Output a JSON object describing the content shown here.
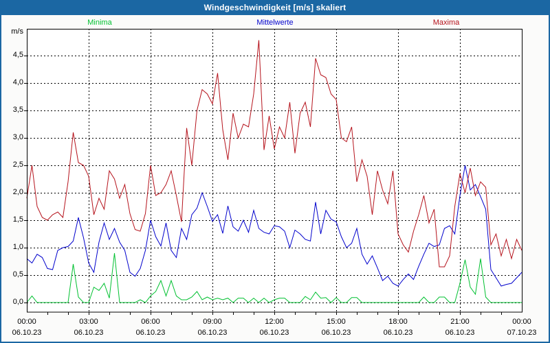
{
  "window": {
    "title": "Windgeschwindigkeit [m/s] skaliert"
  },
  "colors": {
    "titlebar": "#1B67A3",
    "border": "#1B67A3",
    "minima": "#00C030",
    "mittelwerte": "#0000CC",
    "maxima": "#B5121B",
    "grid": "#000000",
    "text": "#000000",
    "plot_bg": "#FFFFFF"
  },
  "legend": {
    "minima_label": "Minima",
    "mittelwerte_label": "Mittelwerte",
    "maxima_label": "Maxima"
  },
  "y_axis": {
    "unit": "m/s",
    "ticks": [
      {
        "value": 0.0,
        "label": "0,0"
      },
      {
        "value": 0.5,
        "label": "0,5"
      },
      {
        "value": 1.0,
        "label": "1,0"
      },
      {
        "value": 1.5,
        "label": "1,5"
      },
      {
        "value": 2.0,
        "label": "2,0"
      },
      {
        "value": 2.5,
        "label": "2,5"
      },
      {
        "value": 3.0,
        "label": "3,0"
      },
      {
        "value": 3.5,
        "label": "3,5"
      },
      {
        "value": 4.0,
        "label": "4,0"
      },
      {
        "value": 4.5,
        "label": "4,5"
      }
    ]
  },
  "x_axis": {
    "ticks": [
      {
        "time": "00:00",
        "date": "06.10.23"
      },
      {
        "time": "03:00",
        "date": "06.10.23"
      },
      {
        "time": "06:00",
        "date": "06.10.23"
      },
      {
        "time": "09:00",
        "date": "06.10.23"
      },
      {
        "time": "12:00",
        "date": "06.10.23"
      },
      {
        "time": "15:00",
        "date": "06.10.23"
      },
      {
        "time": "18:00",
        "date": "06.10.23"
      },
      {
        "time": "21:00",
        "date": "06.10.23"
      },
      {
        "time": "00:00",
        "date": "07.10.23"
      }
    ]
  },
  "chart_data": {
    "type": "line",
    "title": "Windgeschwindigkeit [m/s] skaliert",
    "ylabel": "m/s",
    "ylim": [
      0,
      5.0
    ],
    "xlim_hours": [
      0,
      24
    ],
    "x_start_hours": 0,
    "x_step_hours": 0.25,
    "grid": "dashed, every 0.5 m/s horizontal and every 3 h vertical",
    "legend_position": "top",
    "series": [
      {
        "name": "Minima",
        "color": "#00C030",
        "values": [
          0,
          0.12,
          0,
          0,
          0,
          0,
          0,
          0,
          0,
          0.7,
          0.1,
          0,
          0,
          0.28,
          0.22,
          0.35,
          0.08,
          0.9,
          0,
          0,
          0,
          0,
          0.05,
          0,
          0.12,
          0.2,
          0.4,
          0.12,
          0.4,
          0.12,
          0.05,
          0.05,
          0.1,
          0.2,
          0.05,
          0.1,
          0.05,
          0.08,
          0.05,
          0.08,
          0,
          0.08,
          0.08,
          0,
          0.08,
          0,
          0.08,
          0,
          0.05,
          0.08,
          0.08,
          0,
          0,
          0,
          0.11,
          0.05,
          0.19,
          0.08,
          0.09,
          0,
          0.09,
          0,
          0,
          0.09,
          0.09,
          0,
          0,
          0,
          0,
          0,
          0,
          0,
          0,
          0,
          0,
          0,
          0,
          0.1,
          0,
          0,
          0.1,
          0.1,
          0,
          0,
          0.35,
          0.78,
          0.28,
          0.15,
          0.8,
          0.1,
          0,
          0,
          0,
          0,
          0,
          0,
          0
        ]
      },
      {
        "name": "Mittelwerte",
        "color": "#0000CC",
        "values": [
          0.8,
          0.72,
          0.88,
          0.82,
          0.62,
          0.6,
          0.95,
          1.0,
          1.02,
          1.12,
          1.55,
          1.18,
          0.72,
          0.55,
          1.1,
          1.45,
          1.15,
          1.35,
          1.1,
          0.95,
          0.55,
          0.48,
          0.62,
          0.95,
          1.5,
          1.2,
          1.03,
          1.45,
          0.95,
          0.82,
          1.35,
          1.15,
          1.6,
          1.72,
          2.0,
          1.75,
          1.48,
          1.6,
          1.26,
          1.76,
          1.38,
          1.3,
          1.5,
          1.28,
          1.68,
          1.35,
          1.28,
          1.25,
          1.4,
          1.38,
          1.3,
          1.0,
          1.32,
          1.25,
          1.15,
          1.12,
          1.83,
          1.25,
          1.68,
          1.52,
          1.47,
          1.2,
          1.0,
          1.08,
          1.35,
          0.88,
          0.7,
          0.85,
          0.63,
          0.4,
          0.48,
          0.35,
          0.3,
          0.42,
          0.52,
          0.42,
          0.66,
          0.88,
          1.08,
          1.02,
          1.05,
          1.35,
          1.4,
          1.25,
          1.95,
          2.5,
          2.05,
          2.15,
          1.93,
          1.7,
          0.6,
          0.45,
          0.3,
          0.33,
          0.35,
          0.45,
          0.55
        ]
      },
      {
        "name": "Maxima",
        "color": "#B5121B",
        "values": [
          1.9,
          2.5,
          1.75,
          1.55,
          1.5,
          1.6,
          1.65,
          1.55,
          2.2,
          3.1,
          2.55,
          2.5,
          2.3,
          1.6,
          1.9,
          1.7,
          2.4,
          2.25,
          1.9,
          2.15,
          1.62,
          1.33,
          1.3,
          1.62,
          2.5,
          1.95,
          2.0,
          2.15,
          2.4,
          1.95,
          1.47,
          3.18,
          2.5,
          3.5,
          3.88,
          3.8,
          3.62,
          4.18,
          3.15,
          2.6,
          3.45,
          3.0,
          3.25,
          3.2,
          3.8,
          4.78,
          2.78,
          3.4,
          2.8,
          3.2,
          3.0,
          3.65,
          2.72,
          3.45,
          3.65,
          3.2,
          4.45,
          4.15,
          4.1,
          3.8,
          3.7,
          3.0,
          2.93,
          3.2,
          2.2,
          2.6,
          2.3,
          1.6,
          2.4,
          2.05,
          1.8,
          2.4,
          1.25,
          1.05,
          0.92,
          1.3,
          1.6,
          1.95,
          1.45,
          1.7,
          0.65,
          0.65,
          0.85,
          1.75,
          2.35,
          2.0,
          2.45,
          1.95,
          2.2,
          2.1,
          1.05,
          1.25,
          0.85,
          1.15,
          0.8,
          1.15,
          0.95
        ]
      }
    ]
  }
}
